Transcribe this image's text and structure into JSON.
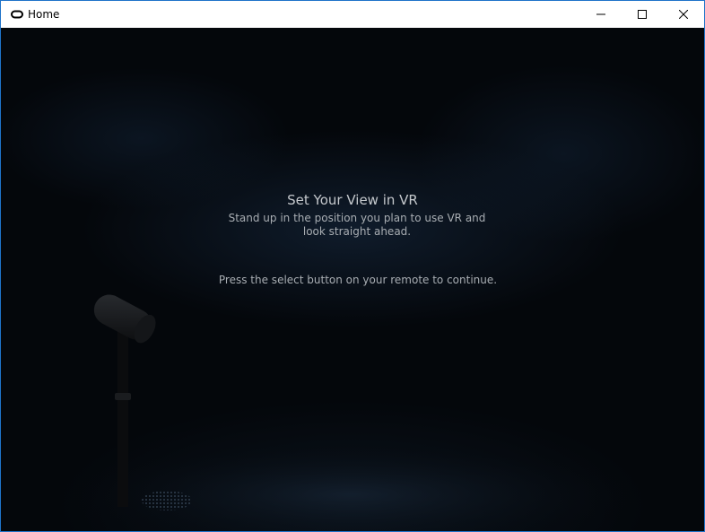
{
  "window": {
    "title": "Home",
    "app_icon": "oculus-ring-icon",
    "controls": {
      "minimize_icon": "minimize-icon",
      "maximize_icon": "maximize-icon",
      "close_icon": "close-icon"
    },
    "accent_border": "#1f73c9"
  },
  "vr_prompt": {
    "title": "Set Your View in VR",
    "instruction": "Stand up in the position you plan to use VR and look straight ahead.",
    "continue_text": "Press the select button on your remote to continue."
  },
  "scene": {
    "object_icon": "sensor-stand-icon",
    "background_color": "#04070b",
    "text_color": "#c4c8cc"
  }
}
